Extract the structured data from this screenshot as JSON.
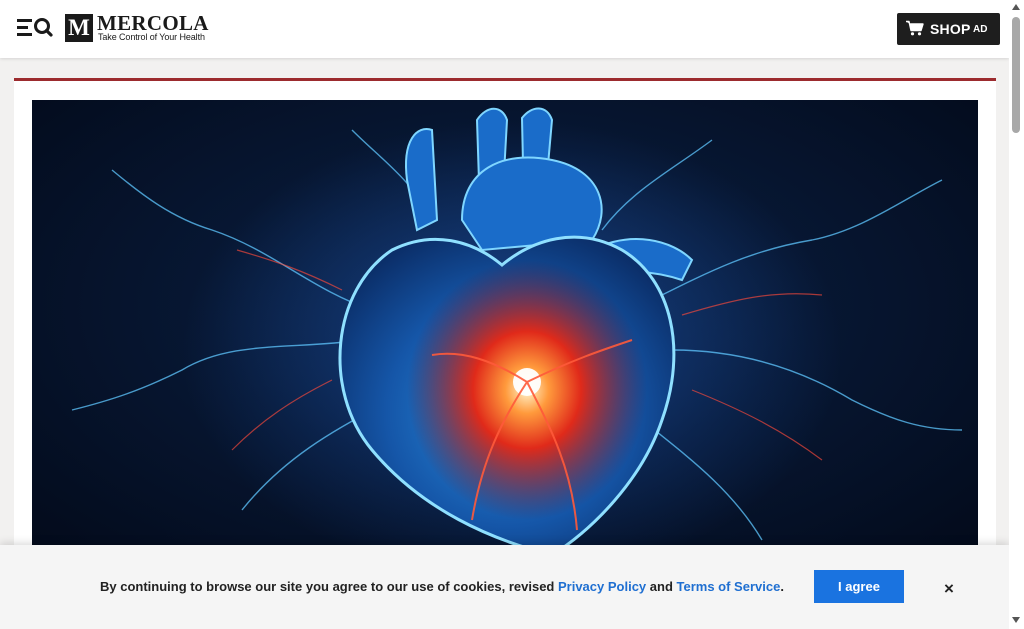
{
  "header": {
    "menu_icon": "menu-search-icon",
    "logo": {
      "mark": "M",
      "name": "MERCOLA",
      "tagline": "Take Control of Your Health"
    },
    "shop_button": {
      "icon": "cart-icon",
      "label": "SHOP",
      "badge": "AD"
    }
  },
  "main": {
    "hero_image": {
      "subject": "glowing-heart-illustration"
    }
  },
  "cookie_banner": {
    "text_before": "By continuing to browse our site you agree to our use of cookies, revised ",
    "privacy_link": "Privacy Policy",
    "text_and": " and ",
    "terms_link": "Terms of Service",
    "text_after": ".",
    "agree_label": "I agree",
    "close_label": "×"
  },
  "colors": {
    "accent_rule": "#9c2b2e",
    "link": "#1f6fd1",
    "agree_button": "#1a73e0",
    "shop_button": "#1e1e1e"
  }
}
